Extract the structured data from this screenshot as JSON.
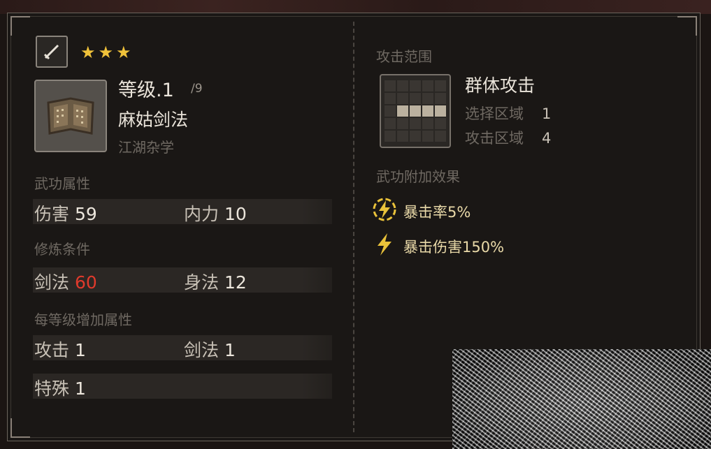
{
  "skill": {
    "star_count": 3,
    "stars": "★★★",
    "level_label": "等级.1",
    "level_max": "/9",
    "name": "麻姑剑法",
    "category": "江湖杂学"
  },
  "attributes": {
    "title": "武功属性",
    "items": [
      {
        "label": "伤害",
        "value": "59"
      },
      {
        "label": "内力",
        "value": "10"
      }
    ]
  },
  "requirements": {
    "title": "修炼条件",
    "items": [
      {
        "label": "剑法",
        "value": "60",
        "color": "#e03a2c"
      },
      {
        "label": "身法",
        "value": "12"
      }
    ]
  },
  "per_level": {
    "title": "每等级增加属性",
    "items": [
      {
        "label": "攻击",
        "value": "1"
      },
      {
        "label": "剑法",
        "value": "1"
      },
      {
        "label": "特殊",
        "value": "1"
      }
    ]
  },
  "range": {
    "title": "攻击范围",
    "type": "群体攻击",
    "select_label": "选择区域",
    "select_value": "1",
    "attack_label": "攻击区域",
    "attack_value": "4"
  },
  "effects": {
    "title": "武功附加效果",
    "items": [
      {
        "icon": "lightning-circle-icon",
        "text": "暴击率5%"
      },
      {
        "icon": "lightning-icon",
        "text": "暴击伤害150%"
      }
    ]
  },
  "colors": {
    "star": "#f0c23a",
    "requirement_unmet": "#e03a2c",
    "effect_text": "#e9d9a8"
  }
}
